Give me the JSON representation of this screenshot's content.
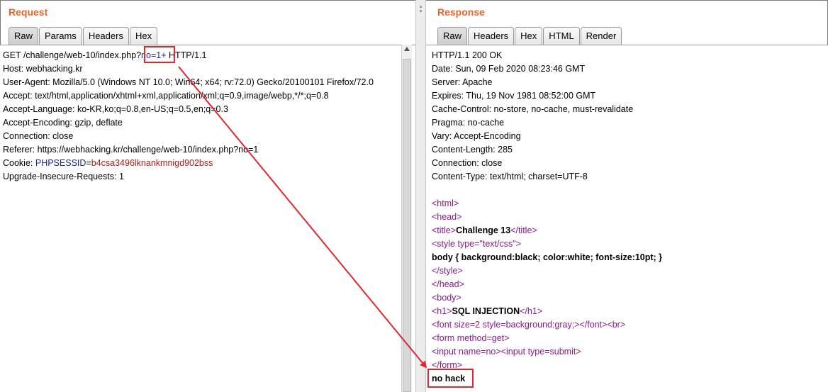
{
  "request": {
    "title": "Request",
    "tabs": [
      "Raw",
      "Params",
      "Headers",
      "Hex"
    ],
    "active_tab": "Raw",
    "lines": {
      "request_line_pre": "GET /challenge/web-10/index.php?",
      "request_line_param": "no=1+",
      "request_line_post": " HTTP/1.1",
      "host": "Host: webhacking.kr",
      "user_agent": "User-Agent: Mozilla/5.0 (Windows NT 10.0; Win64; x64; rv:72.0) Gecko/20100101 Firefox/72.0",
      "accept": "Accept: text/html,application/xhtml+xml,application/xml;q=0.9,image/webp,*/*;q=0.8",
      "accept_language": "Accept-Language: ko-KR,ko;q=0.8,en-US;q=0.5,en;q=0.3",
      "accept_encoding": "Accept-Encoding: gzip, deflate",
      "connection": "Connection: close",
      "referer": "Referer: https://webhacking.kr/challenge/web-10/index.php?no=1",
      "cookie_label": "Cookie: ",
      "cookie_name": "PHPSESSID",
      "cookie_eq": "=",
      "cookie_value": "b4csa3496lknankmnigd902bss",
      "upgrade": "Upgrade-Insecure-Requests: 1"
    }
  },
  "response": {
    "title": "Response",
    "tabs": [
      "Raw",
      "Headers",
      "Hex",
      "HTML",
      "Render"
    ],
    "active_tab": "Raw",
    "headers": [
      "HTTP/1.1 200 OK",
      "Date: Sun, 09 Feb 2020 08:23:46 GMT",
      "Server: Apache",
      "Expires: Thu, 19 Nov 1981 08:52:00 GMT",
      "Cache-Control: no-store, no-cache, must-revalidate",
      "Pragma: no-cache",
      "Vary: Accept-Encoding",
      "Content-Length: 285",
      "Connection: close",
      "Content-Type: text/html; charset=UTF-8"
    ],
    "body": {
      "html_open": "<html>",
      "head_open": "<head>",
      "title_open": "<title>",
      "title_text": "Challenge 13",
      "title_close": "</title>",
      "style_open_a": "<style ",
      "style_attr": "type=",
      "style_val": "\"text/css\"",
      "style_open_b": ">",
      "css_text": "body { background:black; color:white; font-size:10pt; }",
      "style_close": "</style>",
      "head_close": "</head>",
      "body_open": "<body>",
      "h1_open": "<h1>",
      "h1_text": "SQL INJECTION",
      "h1_close": "</h1>",
      "font_open_a": "<font ",
      "font_attr1": "size=",
      "font_val1": "2",
      "font_attr2": " style=",
      "font_val2": "background:gray;",
      "font_rest": "></font><br>",
      "form_open_a": "<form ",
      "form_attr": "method=",
      "form_val": "get",
      "form_open_b": ">",
      "input1_a": "<input ",
      "input1_attr": "name=",
      "input1_val": "no",
      "input1_b": "><input ",
      "input2_attr": "type=",
      "input2_val": "submit",
      "input2_b": ">",
      "form_close": "</form>",
      "result_text": "no hack"
    }
  },
  "colors": {
    "title_orange": "#e8642c",
    "annotation_red": "#e0282e",
    "tag_purple": "#8a1a8a",
    "cookie_name_blue": "#1c2a8e",
    "cookie_value_red": "#b01c1c"
  }
}
